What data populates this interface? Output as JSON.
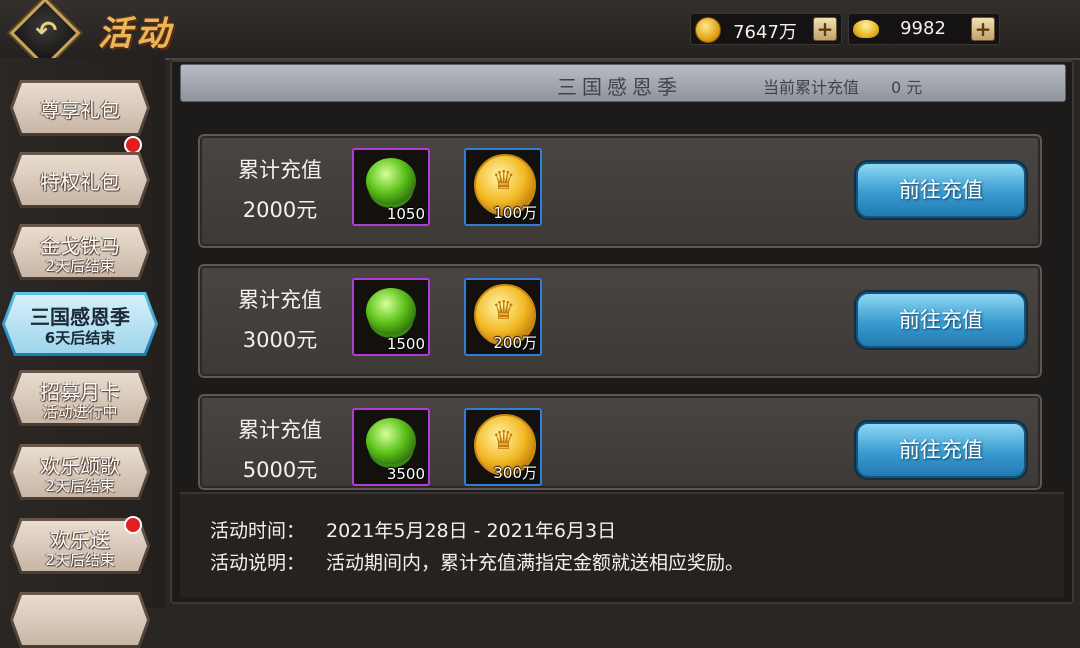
{
  "header": {
    "title": "活动",
    "gold": "7647万",
    "ingot": "9982"
  },
  "sidebar": {
    "items": [
      {
        "label": "尊享礼包",
        "sub": "",
        "badge": true
      },
      {
        "label": "特权礼包",
        "sub": "",
        "badge": false
      },
      {
        "label": "金戈铁马",
        "sub": "2天后结束",
        "badge": false
      },
      {
        "label": "三国感恩季",
        "sub": "6天后结束",
        "badge": false,
        "active": true
      },
      {
        "label": "招募月卡",
        "sub": "活动进行中",
        "badge": false
      },
      {
        "label": "欢乐颂歌",
        "sub": "2天后结束",
        "badge": false
      },
      {
        "label": "欢乐送",
        "sub": "2天后结束",
        "badge": true
      }
    ]
  },
  "event": {
    "title": "三国感恩季",
    "total_label": "当前累计充值",
    "total_value": "0 元",
    "tiers": [
      {
        "label": "累计充值",
        "amount": "2000元",
        "seed_qty": "1050",
        "coin_qty": "100万",
        "button": "前往充值"
      },
      {
        "label": "累计充值",
        "amount": "3000元",
        "seed_qty": "1500",
        "coin_qty": "200万",
        "button": "前往充值"
      },
      {
        "label": "累计充值",
        "amount": "5000元",
        "seed_qty": "3500",
        "coin_qty": "300万",
        "button": "前往充值"
      }
    ],
    "time_label": "活动时间：",
    "time_value": "2021年5月28日 - 2021年6月3日",
    "desc_label": "活动说明：",
    "desc_value": "活动期间内，累计充值满指定金额就送相应奖励。"
  },
  "icons": [
    "back-arrow-icon",
    "gold-coin-icon",
    "gold-ingot-icon",
    "plus-icon",
    "green-seed-icon",
    "coin-reward-icon",
    "red-dot-badge-icon"
  ],
  "colors": {
    "accent_blue": "#3a9bd0",
    "title_gold": "#e9b75a",
    "seed_border": "#b23cd8",
    "coin_border": "#2f7fd8",
    "badge_red": "#e01f1f"
  }
}
